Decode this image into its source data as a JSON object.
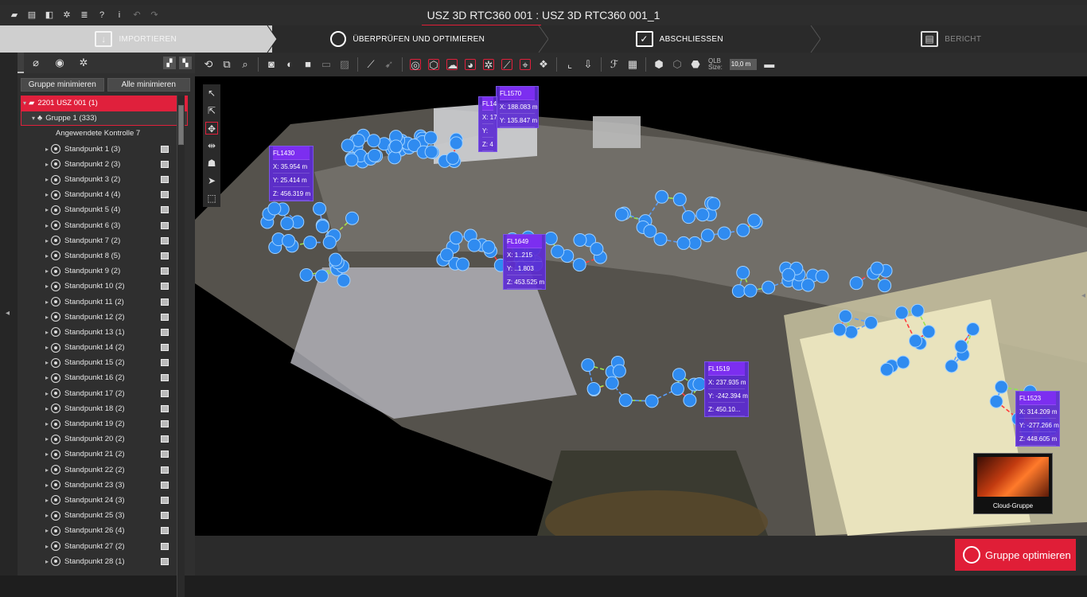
{
  "window": {
    "title": "USZ 3D RTC360 001 : USZ 3D RTC360 001_1"
  },
  "workflow": {
    "steps": [
      {
        "label": "IMPORTIEREN",
        "state": "done"
      },
      {
        "label": "ÜBERPRÜFEN UND OPTIMIEREN",
        "state": "active"
      },
      {
        "label": "ABSCHLIESSEN",
        "state": "normal"
      },
      {
        "label": "BERICHT",
        "state": "inactive"
      }
    ]
  },
  "left_panel": {
    "buttons": {
      "minimize_group": "Gruppe minimieren",
      "minimize_all": "Alle minimieren"
    },
    "tree": {
      "root": "2201 USZ 001 (1)",
      "group": "Gruppe 1 (333)",
      "control": "Angewendete Kontrolle 7",
      "items": [
        "Standpunkt 1 (3)",
        "Standpunkt 2 (3)",
        "Standpunkt 3 (2)",
        "Standpunkt 4 (4)",
        "Standpunkt 5 (4)",
        "Standpunkt 6 (3)",
        "Standpunkt 7 (2)",
        "Standpunkt 8 (5)",
        "Standpunkt 9 (2)",
        "Standpunkt 10 (2)",
        "Standpunkt 11 (2)",
        "Standpunkt 12 (2)",
        "Standpunkt 13 (1)",
        "Standpunkt 14 (2)",
        "Standpunkt 15 (2)",
        "Standpunkt 16 (2)",
        "Standpunkt 17 (2)",
        "Standpunkt 18 (2)",
        "Standpunkt 19 (2)",
        "Standpunkt 20 (2)",
        "Standpunkt 21 (2)",
        "Standpunkt 22 (2)",
        "Standpunkt 23 (3)",
        "Standpunkt 24 (3)",
        "Standpunkt 25 (3)",
        "Standpunkt 26 (4)",
        "Standpunkt 27 (2)",
        "Standpunkt 28 (1)"
      ]
    }
  },
  "toolbar": {
    "qlb_label": "QLB",
    "size_label": "Size:",
    "size_value": "10,0 m"
  },
  "labels": [
    {
      "id": "FL1430",
      "x": "X: 35.954 m",
      "y": "Y: 25.414 m",
      "z": "Z: 456.319 m"
    },
    {
      "id": "FL1570",
      "x": "X: 188.083 m",
      "y": "Y: 135.847 m",
      "z": ""
    },
    {
      "id": "FL14",
      "x": "X: 17",
      "y": "Y: ",
      "z": "Z: 4"
    },
    {
      "id": "FL1649",
      "x": "X: 1..215",
      "y": "Y: ..1.803",
      "z": "Z: 453.525 m"
    },
    {
      "id": "FL1519",
      "x": "X: 237.935 m",
      "y": "Y: -242.394 m",
      "z": "Z: 450.10..."
    },
    {
      "id": "FL1523",
      "x": "X: 314.209 m",
      "y": "Y: -277.266 m",
      "z": "Z: 448.605 m"
    }
  ],
  "thumbnail": {
    "caption": "Cloud-Gruppe"
  },
  "actions": {
    "optimize": "Gruppe optimieren"
  },
  "colors": {
    "accent": "#e01e37",
    "node": "#2f8bf0",
    "label_bg": "#5d2bd2"
  }
}
